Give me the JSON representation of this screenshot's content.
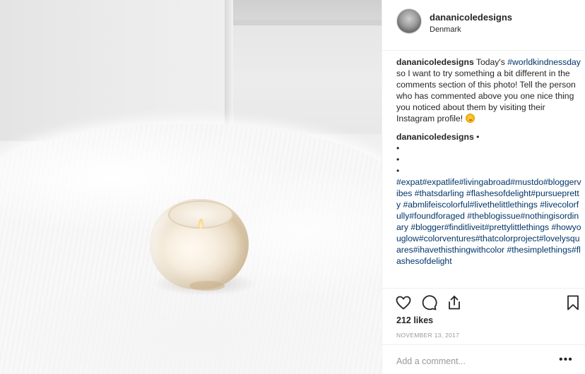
{
  "post": {
    "username": "dananicoledesigns",
    "location": "Denmark",
    "caption_username": "dananicoledesigns",
    "caption_part1": " Today's ",
    "caption_hashtag": "#worldkindnessday",
    "caption_part2": " so I want to try something a bit different in the comments section of this photo! Tell the person who has commented above you one nice thing you noticed about them by visiting their Instagram profile! ",
    "comment_username": "dananicoledesigns",
    "comment_dot": " •",
    "bullet": "•",
    "hashtags": "#expat#expatlife#livingabroad#mustdo#bloggervibes #thatsdarling #flashesofdelight#pursuepretty #abmlifeiscolorful#livethelittlethings #livecolorfully#foundforaged #theblogissue#nothingisordinary #blogger#finditliveit#prettylittlethings #howyouglow#colorventures#thatcolorproject#lovelysquares#ihavethisthingwithcolor #thesimplethings#flashesofdelight",
    "likes": "212 likes",
    "date": "NOVEMBER 13, 2017",
    "add_comment_placeholder": "Add a comment...",
    "more": "•••"
  },
  "icons": {
    "like": "heart-icon",
    "comment": "comment-bubble-icon",
    "share": "share-icon",
    "save": "bookmark-icon"
  }
}
